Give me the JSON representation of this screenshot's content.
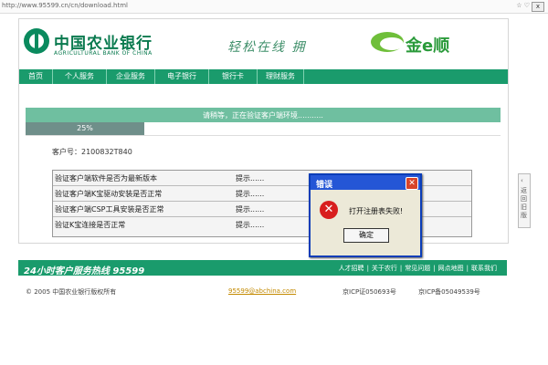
{
  "browser": {
    "url": "http://www.95599.cn/cn/download.html",
    "right_text": "☆ ♡",
    "close_label": "x"
  },
  "header": {
    "bank_name_cn": "中国农业银行",
    "bank_name_en": "AGRICULTURAL BANK OF CHINA",
    "slogan": "轻松在线 拥",
    "product_name": "金e顺"
  },
  "nav": {
    "items": [
      "首页",
      "个人服务",
      "企业服务",
      "电子银行",
      "银行卡",
      "理财服务"
    ]
  },
  "verify": {
    "status_text": "请稍等，正在验证客户端环境...........",
    "progress_percent": 25,
    "progress_label": "25%",
    "client_no": "客户号：2100832T840",
    "checks": [
      {
        "item": "验证客户端软件是否为最新版本",
        "hint": "提示......"
      },
      {
        "item": "验证客户端K宝驱动安装是否正常",
        "hint": "提示......"
      },
      {
        "item": "验证客户端CSP工具安装是否正常",
        "hint": "提示......"
      },
      {
        "item": "验证K宝连接是否正常",
        "hint": "提示......"
      }
    ]
  },
  "dialog": {
    "title": "错误",
    "message": "打开注册表失败!",
    "ok_label": "确定",
    "close_label": "✕",
    "icon": "error-icon"
  },
  "footer": {
    "hotline": "24小时客户服务热线 95599",
    "links": [
      "人才招聘",
      "关于农行",
      "常见问题",
      "网点地图",
      "联系我们"
    ],
    "copyright": "© 2005 中国农业银行版权所有",
    "email": "95599@abchina.com",
    "icp1": "京ICP证050693号",
    "icp2": "京ICP备05049539号"
  },
  "side": {
    "label": "返回旧版",
    "arrow": "‹"
  },
  "colors": {
    "brand_green": "#1a9b6c",
    "status_green": "#6fbfa0",
    "dialog_blue": "#2456d6",
    "error_red": "#d81e1e"
  }
}
